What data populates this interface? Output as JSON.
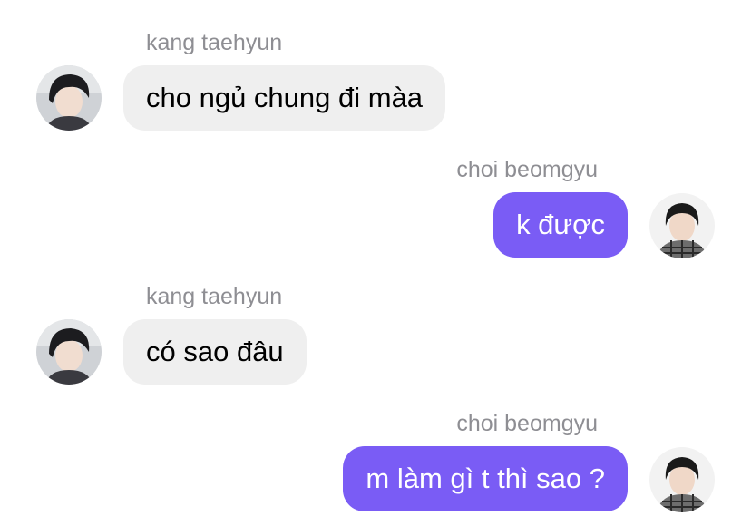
{
  "messages": [
    {
      "sender": "kang taehyun",
      "text": "cho ngủ chung đi màa",
      "direction": "incoming"
    },
    {
      "sender": "choi beomgyu",
      "text": "k được",
      "direction": "outgoing"
    },
    {
      "sender": "kang taehyun",
      "text": "có sao đâu",
      "direction": "incoming"
    },
    {
      "sender": "choi beomgyu",
      "text": "m làm gì t thì sao ?",
      "direction": "outgoing"
    }
  ],
  "colors": {
    "incoming_bubble": "#efefef",
    "outgoing_bubble": "#7a5cf5",
    "sender_name": "#8e8e93"
  }
}
